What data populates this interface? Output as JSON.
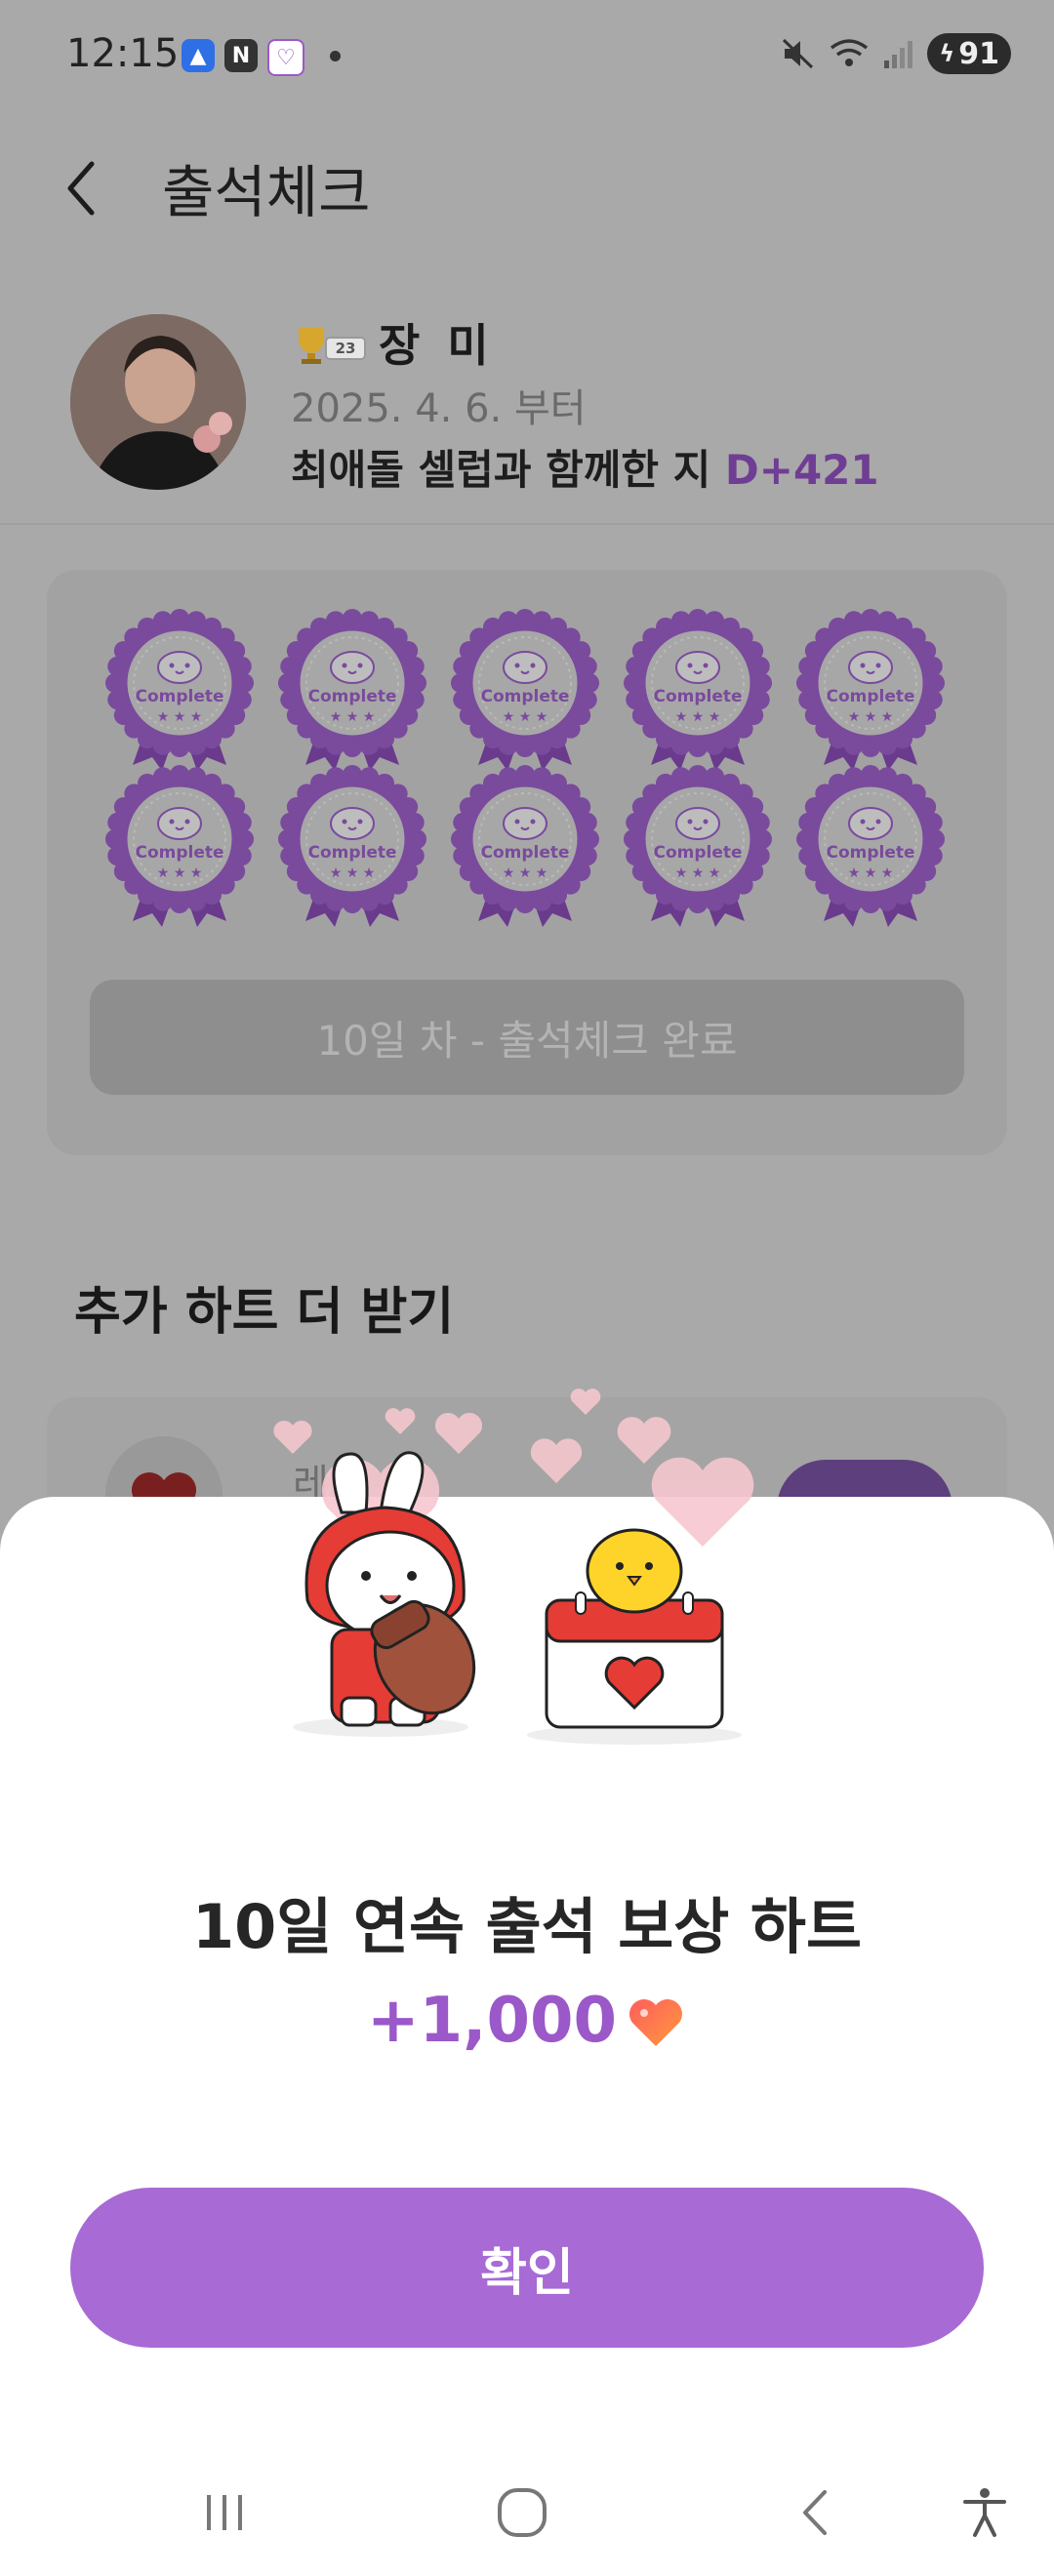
{
  "status_bar": {
    "time": "12:15",
    "app_icons": [
      "assembly-app-icon",
      "naver-n-icon",
      "celeb-app-icon"
    ],
    "battery": "91",
    "icons": [
      "mute-icon",
      "wifi-icon",
      "signal-icon"
    ]
  },
  "header": {
    "title": "출석체크",
    "back_icon": "chevron-left-icon"
  },
  "profile": {
    "level": "23",
    "name": "장 미",
    "since": "2025. 4. 6. 부터",
    "together_text": "최애돌 셀럽과 함께한 지 ",
    "dday": "D+421"
  },
  "stamps": {
    "count": 10,
    "label": "Complete",
    "status_button": "10일 차 - 출석체크 완료"
  },
  "extra_section": {
    "title": "추가 하트 더 받기",
    "item_label": "레벨 "
  },
  "sheet": {
    "title": "10일 연속 출석 보상 하트",
    "amount": "+1,000",
    "confirm_label": "확인"
  },
  "colors": {
    "accent": "#a86ad5",
    "stamp": "#7a4a9d",
    "amount": "#9b58c8"
  }
}
